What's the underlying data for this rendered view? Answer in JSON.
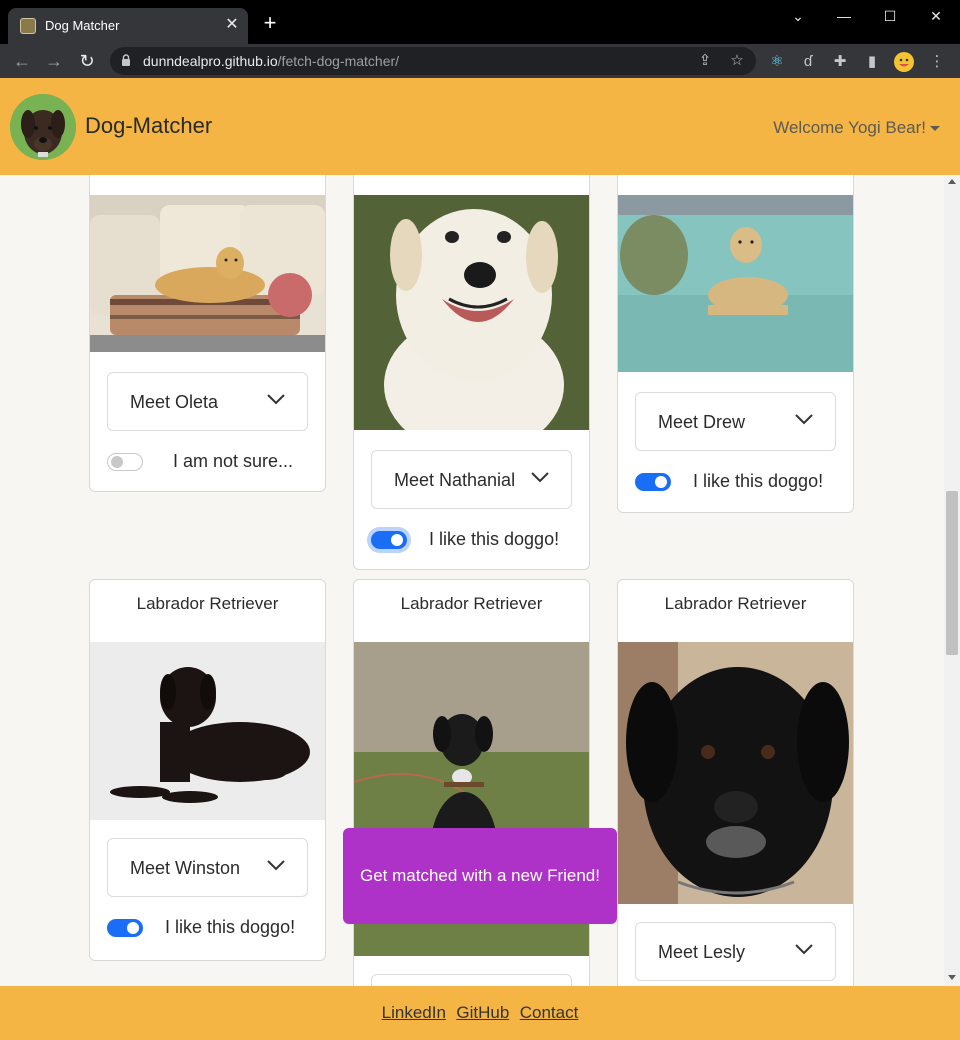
{
  "browser": {
    "tab_title": "Dog Matcher",
    "url_host": "dunndealpro.github.io",
    "url_path": "/fetch-dog-matcher/"
  },
  "app": {
    "brand": "Dog-Matcher",
    "welcome": "Welcome Yogi Bear!",
    "accent": "#f5b544",
    "match_button": "Get matched with a new Friend!",
    "match_color": "#ae32c8"
  },
  "cards": [
    {
      "breed": "",
      "meet": "Meet Oleta",
      "like": "I am not sure...",
      "toggle_on": false
    },
    {
      "breed": "",
      "meet": "Meet Nathanial",
      "like": "I like this doggo!",
      "toggle_on": true
    },
    {
      "breed": "",
      "meet": "Meet Drew",
      "like": "I like this doggo!",
      "toggle_on": true
    },
    {
      "breed": "Labrador Retriever",
      "meet": "Meet Winston",
      "like": "I like this doggo!",
      "toggle_on": true
    },
    {
      "breed": "Labrador Retriever",
      "meet": "",
      "like": "",
      "toggle_on": null
    },
    {
      "breed": "Labrador Retriever",
      "meet": "Meet Lesly",
      "like": "",
      "toggle_on": null
    }
  ],
  "footer": {
    "links": [
      "LinkedIn",
      "GitHub",
      "Contact"
    ]
  }
}
